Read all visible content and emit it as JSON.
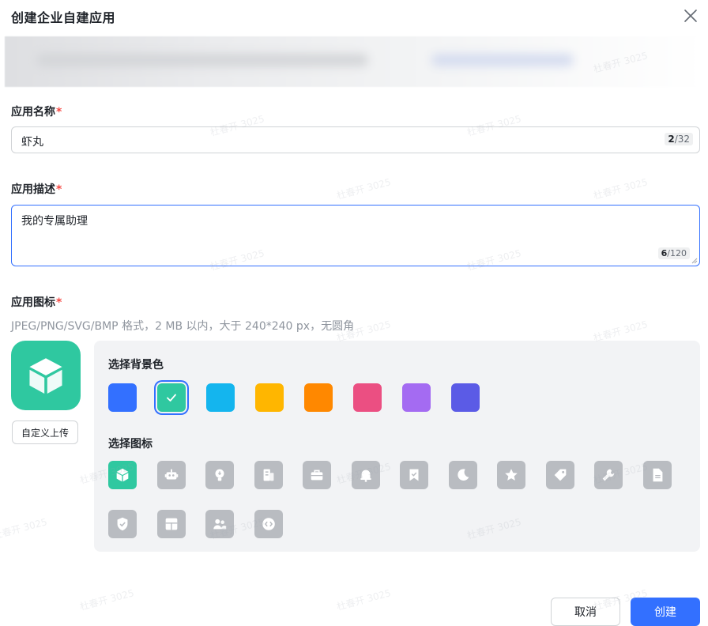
{
  "dialog": {
    "title": "创建企业自建应用"
  },
  "form": {
    "name_label": "应用名称",
    "required_mark": "*",
    "name_value": "虾丸",
    "name_count": "2",
    "name_max": "/32",
    "desc_label": "应用描述",
    "desc_value": "我的专属助理",
    "desc_count": "6",
    "desc_max": "/120",
    "icon_label": "应用图标",
    "icon_hint": "JPEG/PNG/SVG/BMP 格式，2 MB 以内，大于 240*240 px，无圆角",
    "upload_label": "自定义上传"
  },
  "picker": {
    "bg_title": "选择背景色",
    "icon_title": "选择图标",
    "colors": [
      "#3370ff",
      "#2fc8a0",
      "#14b5ee",
      "#ffb600",
      "#ff8800",
      "#eb4f82",
      "#a46bf2",
      "#5b5be6"
    ],
    "selected_color_index": 1,
    "icons": [
      "cube-icon",
      "robot-icon",
      "lightbulb-icon",
      "building-icon",
      "briefcase-icon",
      "bell-icon",
      "bookmark-check-icon",
      "moon-icon",
      "star-icon",
      "tag-icon",
      "wrench-icon",
      "document-icon",
      "shield-check-icon",
      "layout-icon",
      "users-icon",
      "code-icon"
    ],
    "selected_icon_index": 0
  },
  "footer": {
    "cancel_label": "取消",
    "create_label": "创建"
  },
  "watermark": "杜春开 3025"
}
